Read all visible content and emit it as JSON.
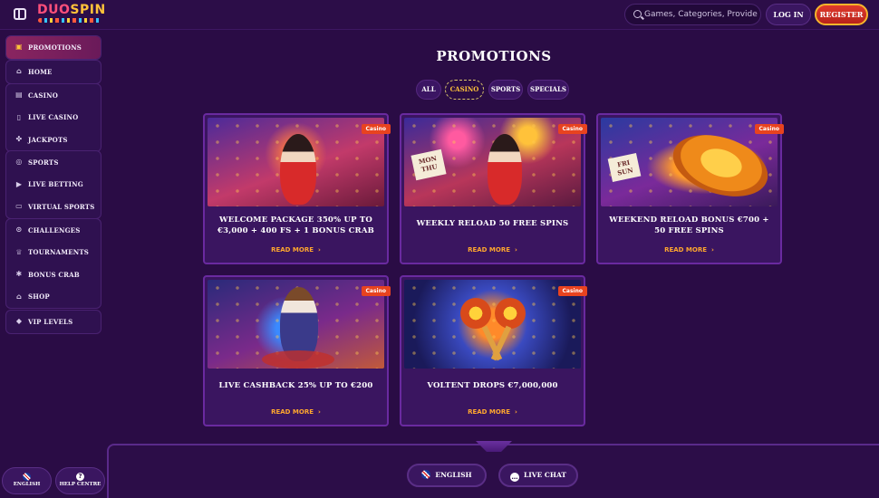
{
  "header": {
    "logo_part1": "DUO",
    "logo_part2": "SPIN",
    "search_placeholder": "Games, Categories, Providers",
    "login_label": "LOG IN",
    "register_label": "REGISTER"
  },
  "sidebar": {
    "groups": [
      {
        "items": [
          {
            "label": "PROMOTIONS",
            "icon": "gift-icon",
            "active": true
          }
        ]
      },
      {
        "items": [
          {
            "label": "HOME",
            "icon": "home-icon"
          }
        ]
      },
      {
        "items": [
          {
            "label": "CASINO",
            "icon": "slot-machine-icon"
          },
          {
            "label": "LIVE CASINO",
            "icon": "live-casino-icon"
          },
          {
            "label": "JACKPOTS",
            "icon": "jackpot-icon"
          }
        ]
      },
      {
        "items": [
          {
            "label": "SPORTS",
            "icon": "ball-icon"
          },
          {
            "label": "LIVE BETTING",
            "icon": "play-icon"
          },
          {
            "label": "VIRTUAL SPORTS",
            "icon": "monitor-icon"
          }
        ]
      },
      {
        "items": [
          {
            "label": "CHALLENGES",
            "icon": "target-icon"
          },
          {
            "label": "TOURNAMENTS",
            "icon": "trophy-icon"
          },
          {
            "label": "BONUS CRAB",
            "icon": "crab-icon"
          },
          {
            "label": "SHOP",
            "icon": "shop-icon"
          }
        ]
      },
      {
        "items": [
          {
            "label": "VIP LEVELS",
            "icon": "diamond-icon"
          }
        ]
      }
    ],
    "bottom": {
      "language_label": "ENGLISH",
      "help_label": "HELP CENTRE"
    }
  },
  "main": {
    "title": "PROMOTIONS",
    "tabs": [
      {
        "label": "ALL",
        "active": false
      },
      {
        "label": "CASINO",
        "active": true
      },
      {
        "label": "SPORTS",
        "active": false
      },
      {
        "label": "SPECIALS",
        "active": false
      }
    ],
    "cards": [
      {
        "badge": "Casino",
        "title": "WELCOME PACKAGE 350% UP TO €3,000 + 400 FS + 1 BONUS CRAB",
        "more": "READ MORE"
      },
      {
        "badge": "Casino",
        "title": "WEEKLY RELOAD 50 FREE SPINS",
        "more": "READ MORE"
      },
      {
        "badge": "Casino",
        "title": "WEEKEND RELOAD BONUS €700 + 50 FREE SPINS",
        "more": "READ MORE"
      },
      {
        "badge": "Casino",
        "title": "LIVE CASHBACK 25% UP TO €200",
        "more": "READ MORE"
      },
      {
        "badge": "Casino",
        "title": "VOLTENT DROPS €7,000,000",
        "more": "READ MORE"
      }
    ],
    "card_image_text": {
      "weekly": "MON THU",
      "weekend": "FRI SUN"
    }
  },
  "footer": {
    "language_label": "ENGLISH",
    "chat_label": "LIVE CHAT"
  },
  "colors": {
    "background": "#2a0c45",
    "accent_orange": "#ffa72e",
    "register_red": "#d02e22",
    "badge": "#e8431f"
  }
}
